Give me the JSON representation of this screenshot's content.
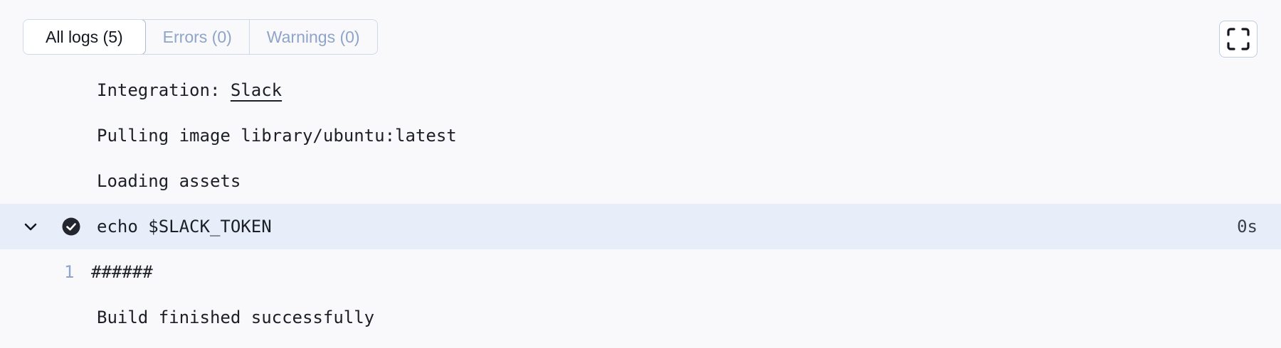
{
  "tabs": [
    {
      "label": "All logs (5)",
      "active": true
    },
    {
      "label": "Errors (0)",
      "active": false
    },
    {
      "label": "Warnings (0)",
      "active": false
    }
  ],
  "fullscreen": {
    "icon": "fullscreen-icon"
  },
  "log": {
    "integration_prefix": "Integration: ",
    "integration_link": "Slack",
    "line_pulling": "Pulling image library/ubuntu:latest",
    "line_loading": "Loading assets",
    "step": {
      "command": "echo $SLACK_TOKEN",
      "duration": "0s",
      "status_icon": "check-circle-icon",
      "toggle_icon": "chevron-down-icon",
      "output": [
        {
          "line_number": "1",
          "text": "######"
        }
      ]
    },
    "line_finished": "Build finished successfully"
  },
  "colors": {
    "background": "#f9f9fb",
    "step_highlight": "#e8eef9",
    "muted_text": "#8ea4c8",
    "border": "#cfd9e8"
  }
}
